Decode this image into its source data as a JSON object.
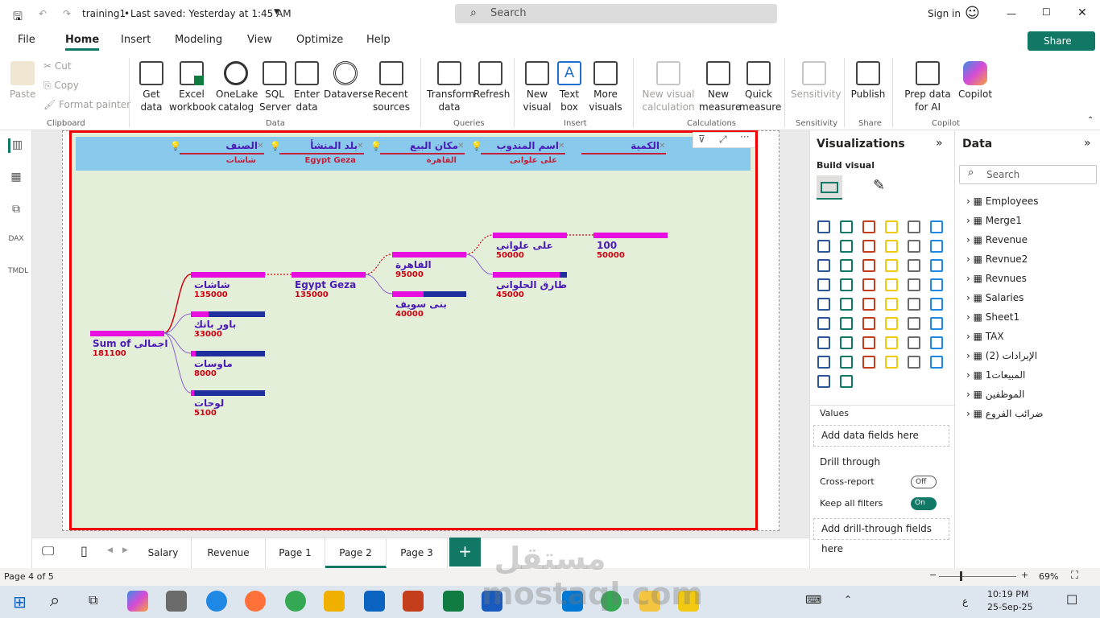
{
  "titlebar": {
    "doc_title": "training1",
    "saved": "Last saved: Yesterday at 1:45 AM",
    "search": "Search",
    "signin": "Sign in"
  },
  "menu": {
    "file": "File",
    "home": "Home",
    "insert": "Insert",
    "modeling": "Modeling",
    "view": "View",
    "optimize": "Optimize",
    "help": "Help",
    "share": "Share"
  },
  "ribbon": {
    "paste": "Paste",
    "cut": "Cut",
    "copy": "Copy",
    "format_painter": "Format painter",
    "get_data": "Get data",
    "excel": "Excel workbook",
    "onelake": "OneLake catalog",
    "sql": "SQL Server",
    "enter": "Enter data",
    "dataverse": "Dataverse",
    "recent": "Recent sources",
    "transform": "Transform data",
    "refresh": "Refresh",
    "new_visual": "New visual",
    "text_box": "Text box",
    "more_visuals": "More visuals",
    "new_calc": "New visual calculation",
    "new_measure": "New measure",
    "quick_measure": "Quick measure",
    "sensitivity": "Sensitivity",
    "publish": "Publish",
    "prep_ai": "Prep data for AI",
    "copilot": "Copilot",
    "g_clipboard": "Clipboard",
    "g_data": "Data",
    "g_queries": "Queries",
    "g_insert": "Insert",
    "g_calc": "Calculations",
    "g_sens": "Sensitivity",
    "g_share": "Share",
    "g_copilot": "Copilot"
  },
  "slicers": [
    {
      "header": "الصنف",
      "value": "شاشات"
    },
    {
      "header": "بلد المنشأ",
      "value": "Egypt Geza"
    },
    {
      "header": "مكان البيع",
      "value": "القاهرة"
    },
    {
      "header": "اسم المندوب",
      "value": "على علوانى"
    },
    {
      "header": "الكمية",
      "value": ""
    }
  ],
  "tree": {
    "root": {
      "label": "Sum of اجمالى",
      "value": "181100",
      "fill": 1.0
    },
    "level1": [
      {
        "label": "شاشات",
        "value": "135000",
        "fill": 1.0
      },
      {
        "label": "باور بانك",
        "value": "33000",
        "fill": 0.24
      },
      {
        "label": "ماوسات",
        "value": "8000",
        "fill": 0.06
      },
      {
        "label": "لوحات",
        "value": "5100",
        "fill": 0.04
      }
    ],
    "level2": [
      {
        "label": "Egypt Geza",
        "value": "135000",
        "fill": 1.0
      }
    ],
    "level3": [
      {
        "label": "القاهرة",
        "value": "95000",
        "fill": 1.0
      },
      {
        "label": "بنى سويف",
        "value": "40000",
        "fill": 0.42
      }
    ],
    "level4": [
      {
        "label": "على علوانى",
        "value": "50000",
        "fill": 1.0
      },
      {
        "label": "طارق الحلوانى",
        "value": "45000",
        "fill": 0.9
      }
    ],
    "level5": [
      {
        "label": "100",
        "value": "50000",
        "fill": 1.0
      }
    ]
  },
  "viz": {
    "title": "Visualizations",
    "build": "Build visual",
    "values": "Values",
    "add_data": "Add data fields here",
    "drill": "Drill through",
    "cross": "Cross-report",
    "cross_state": "Off",
    "keep": "Keep all filters",
    "keep_state": "On",
    "add_drill": "Add drill-through fields here"
  },
  "data": {
    "title": "Data",
    "search": "Search",
    "tables": [
      "Employees",
      "Merge1",
      "Revenue",
      "Revnue2",
      "Revnues",
      "Salaries",
      "Sheet1",
      "TAX",
      "الإيرادات (2)",
      "المبيعات1",
      "الموظفين",
      "ضرائب الفروع"
    ]
  },
  "pages": [
    "Salary",
    "Revenue",
    "Page 1",
    "Page 2",
    "Page 3"
  ],
  "status": {
    "page": "Page 4 of 5",
    "zoom": "69%"
  },
  "taskbar": {
    "time": "10:19 PM",
    "date": "25-Sep-25",
    "lang": "ع"
  },
  "watermark": "مستقل mostaql.com",
  "colors": {
    "accent": "#117865",
    "bar_fill": "#e60fe0",
    "bar_track": "#1f2f9e",
    "label": "#4b1bb8",
    "value": "#d10010",
    "visual_border": "#ee0000",
    "slicer_bg": "#89c9ec",
    "visual_bg": "#e3efd9"
  }
}
